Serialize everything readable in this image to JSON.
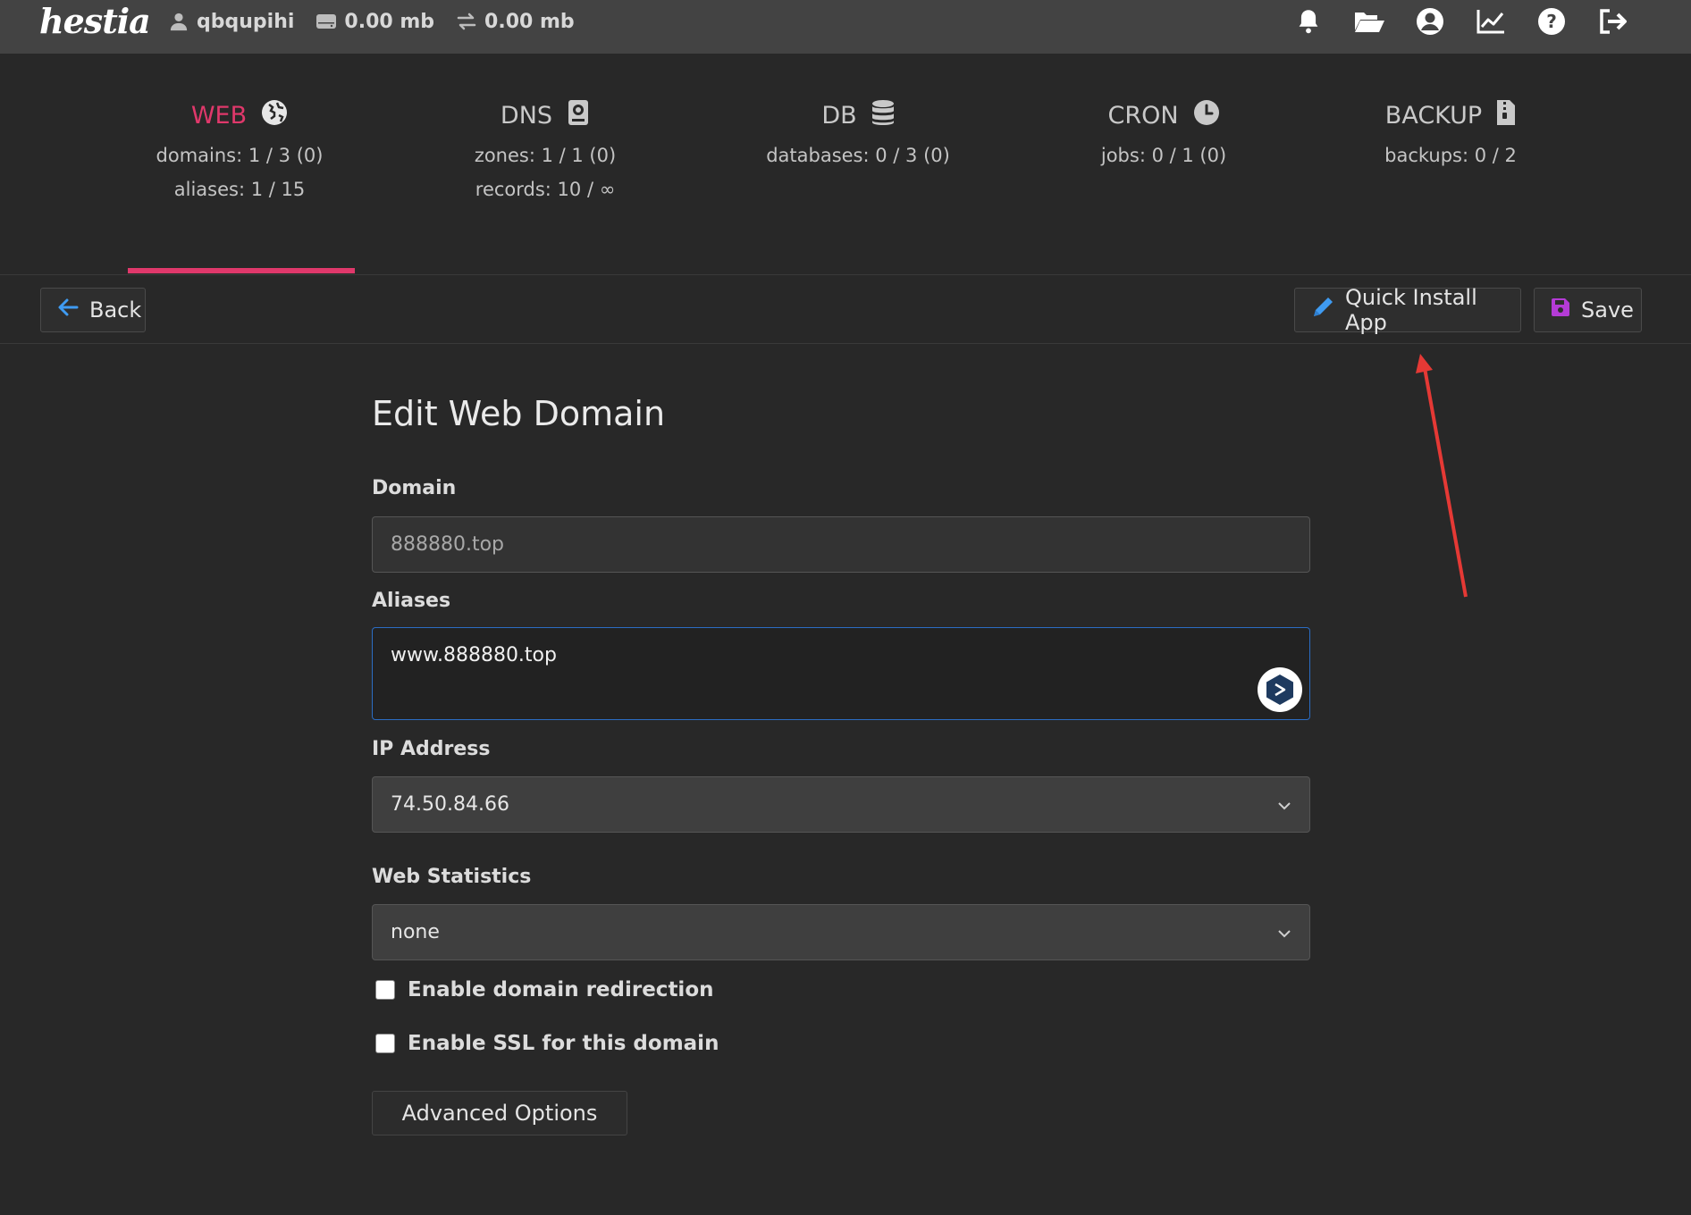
{
  "header": {
    "logo_text": "hestia",
    "username": "qbqupihi",
    "disk_usage": "0.00 mb",
    "bandwidth": "0.00 mb",
    "icons": [
      "user-icon",
      "disk-icon",
      "transfer-icon",
      "bell-icon",
      "folder-open-icon",
      "account-circle-icon",
      "chart-line-icon",
      "help-icon",
      "logout-icon"
    ]
  },
  "stats": [
    {
      "title": "WEB",
      "icon": "globe-icon",
      "lines": [
        "domains: 1 / 3 (0)",
        "aliases: 1 / 15"
      ],
      "active": true
    },
    {
      "title": "DNS",
      "icon": "address-book-icon",
      "lines": [
        "zones: 1 / 1 (0)",
        "records: 10 / ∞"
      ],
      "active": false
    },
    {
      "title": "DB",
      "icon": "database-icon",
      "lines": [
        "databases: 0 / 3 (0)"
      ],
      "active": false
    },
    {
      "title": "CRON",
      "icon": "clock-icon",
      "lines": [
        "jobs: 0 / 1 (0)"
      ],
      "active": false
    },
    {
      "title": "BACKUP",
      "icon": "file-zip-icon",
      "lines": [
        "backups: 0 / 2"
      ],
      "active": false
    }
  ],
  "toolbar": {
    "back_label": "Back",
    "quick_install_label": "Quick Install App",
    "save_label": "Save"
  },
  "form": {
    "title": "Edit Web Domain",
    "domain_label": "Domain",
    "domain_value": "888880.top",
    "aliases_label": "Aliases",
    "aliases_value": "www.888880.top",
    "ip_label": "IP Address",
    "ip_value": "74.50.84.66",
    "stats_label": "Web Statistics",
    "stats_value": "none",
    "redirect_label": "Enable domain redirection",
    "redirect_checked": false,
    "ssl_label": "Enable SSL for this domain",
    "ssl_checked": false,
    "advanced_label": "Advanced Options"
  },
  "colors": {
    "accent": "#e0386b",
    "background": "#282828",
    "topbar": "#434343",
    "focus_border": "#2b6dc4",
    "save_icon": "#b43bd6",
    "annotation_arrow": "#e53935"
  }
}
